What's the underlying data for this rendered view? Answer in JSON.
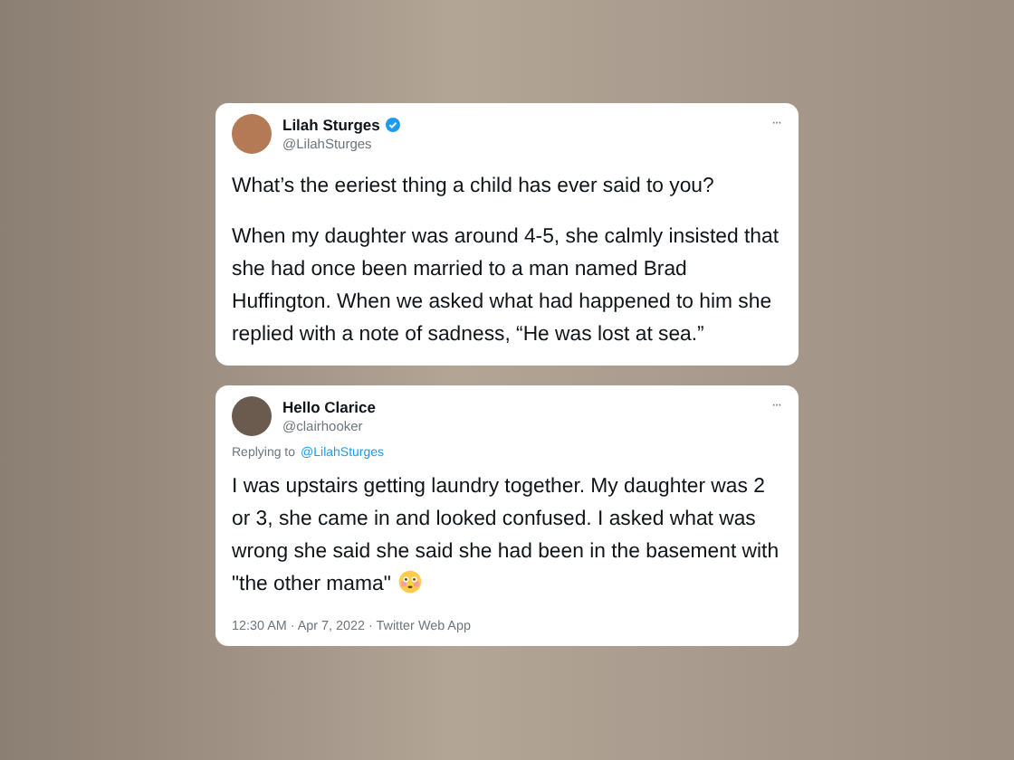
{
  "tweets": [
    {
      "name": "Lilah Sturges",
      "handle": "@LilahSturges",
      "verified": true,
      "more": "···",
      "paragraphs": [
        "What’s the eeriest thing a child has ever said to you?",
        "When my daughter was around 4-5, she calmly insisted that she had once been married to a man named Brad Huffington. When we asked what had happened to him she replied with a note of sadness, “He was lost at sea.”"
      ]
    },
    {
      "name": "Hello Clarice",
      "handle": "@clairhooker",
      "verified": false,
      "more": "···",
      "replying_label": "Replying to",
      "replying_to": "@LilahSturges",
      "paragraphs": [
        "I was upstairs getting laundry together. My daughter was 2 or 3, she came in and looked confused. I asked what was wrong she said she said she had been in the basement with \"the other mama\""
      ],
      "emoji": true,
      "meta": "12:30 AM · Apr 7, 2022 · Twitter Web App"
    }
  ]
}
